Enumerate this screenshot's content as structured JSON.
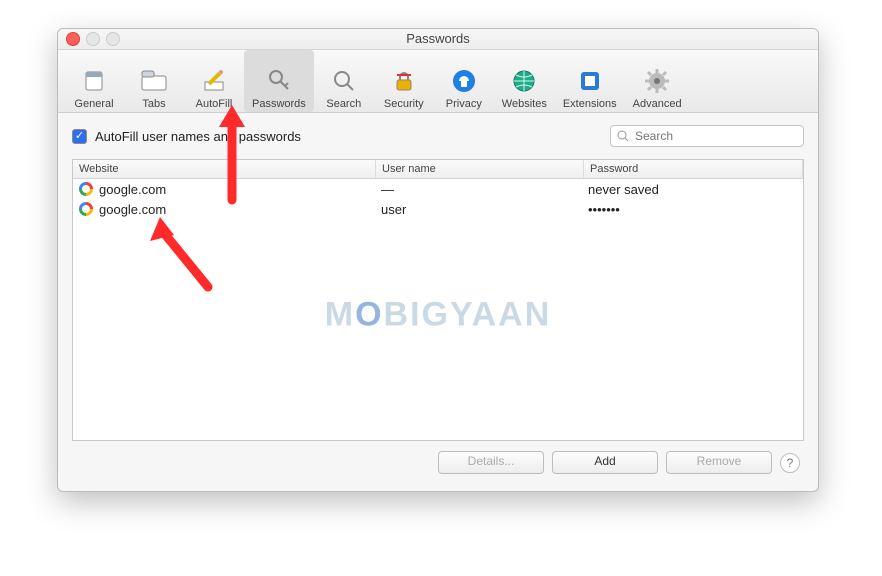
{
  "window_title": "Passwords",
  "toolbar": [
    {
      "label": "General"
    },
    {
      "label": "Tabs"
    },
    {
      "label": "AutoFill"
    },
    {
      "label": "Passwords",
      "selected": true
    },
    {
      "label": "Search"
    },
    {
      "label": "Security"
    },
    {
      "label": "Privacy"
    },
    {
      "label": "Websites"
    },
    {
      "label": "Extensions"
    },
    {
      "label": "Advanced"
    }
  ],
  "autofill_checkbox_label": "AutoFill user names and passwords",
  "autofill_checked": true,
  "search_placeholder": "Search",
  "table": {
    "headers": {
      "website": "Website",
      "username": "User name",
      "password": "Password"
    },
    "rows": [
      {
        "site": "google.com",
        "user": "—",
        "pass": "never saved"
      },
      {
        "site": "google.com",
        "user": "user",
        "pass": "•••••••"
      }
    ]
  },
  "buttons": {
    "details": "Details...",
    "add": "Add",
    "remove": "Remove"
  },
  "help_tooltip": "?",
  "watermark": {
    "pre": "M",
    "o": "O",
    "post": "BIGYAAN"
  }
}
